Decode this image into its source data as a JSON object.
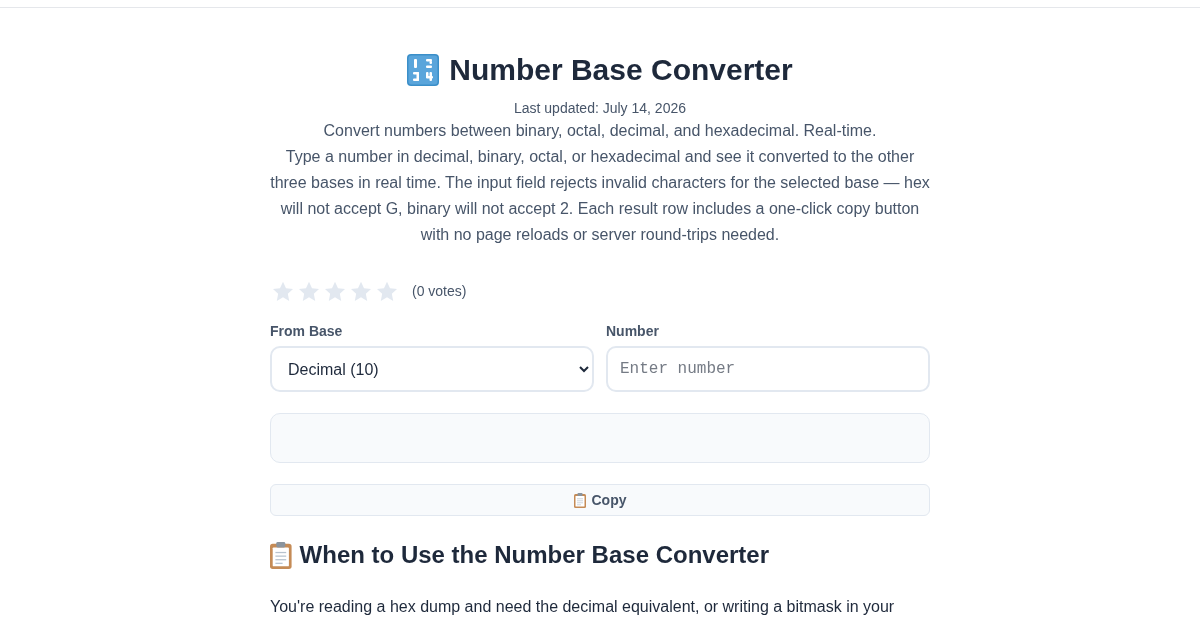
{
  "title": "Number Base Converter",
  "last_updated": "Last updated: July 14, 2026",
  "tagline": "Convert numbers between binary, octal, decimal, and hexadecimal. Real-time.",
  "description": "Type a number in decimal, binary, octal, or hexadecimal and see it converted to the other three bases in real time. The input field rejects invalid characters for the selected base — hex will not accept G, binary will not accept 2. Each result row includes a one-click copy button with no page reloads or server round-trips needed.",
  "rating": {
    "stars": 0,
    "votes": "(0 votes)"
  },
  "form": {
    "from_base": {
      "label": "From Base",
      "value": "Decimal (10)"
    },
    "number": {
      "label": "Number",
      "placeholder": "Enter number"
    }
  },
  "copy_button": "Copy",
  "section": {
    "heading": "When to Use the Number Base Converter",
    "paragraph": "You're reading a hex dump and need the decimal equivalent, or writing a bitmask in your"
  }
}
